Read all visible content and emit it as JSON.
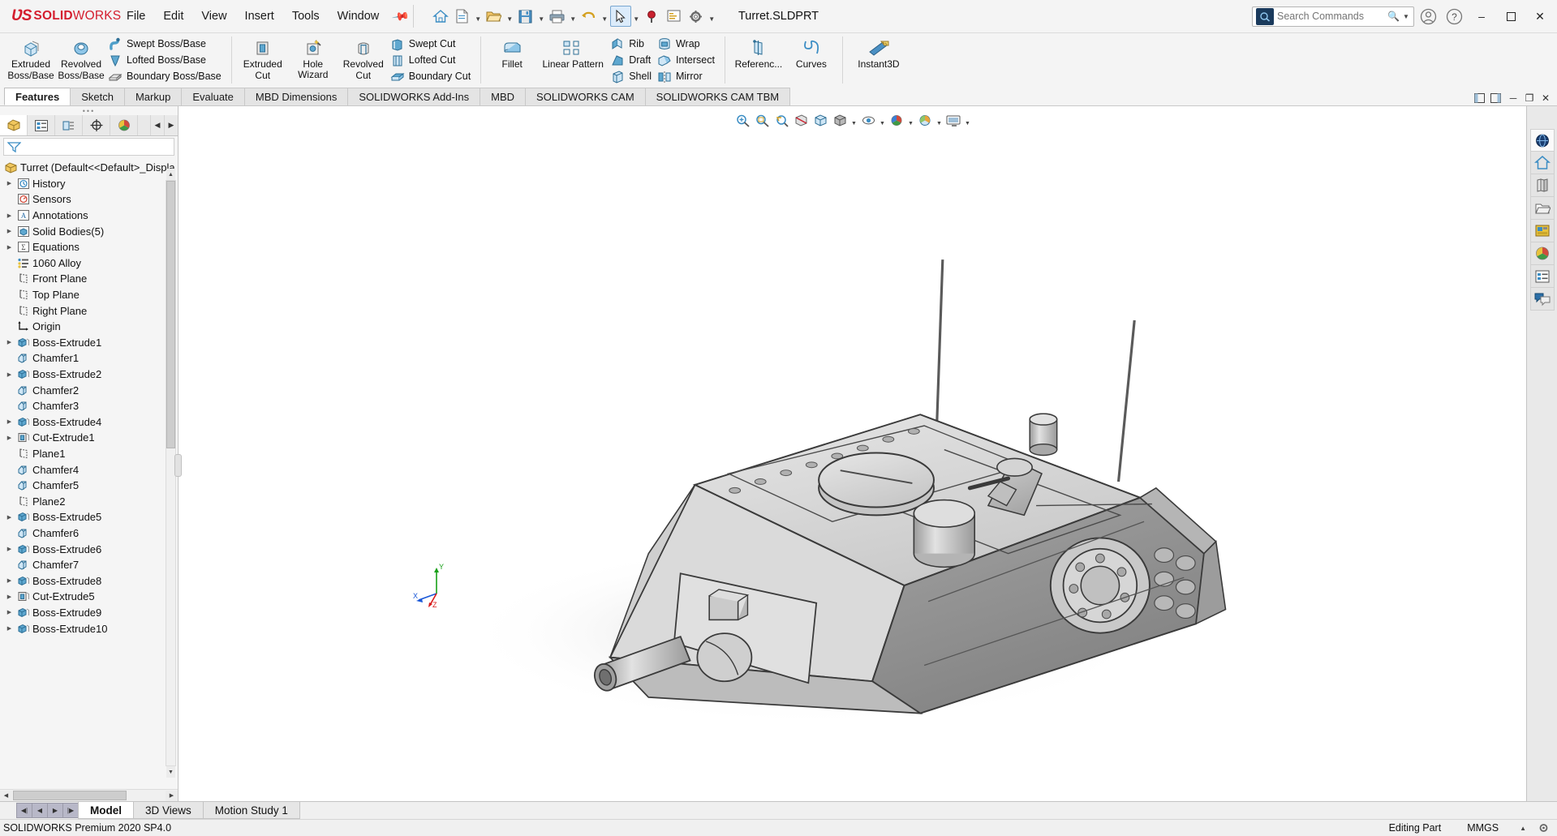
{
  "app": {
    "brand_bold": "SOLID",
    "brand_light": "WORKS",
    "window_title": "Turret.SLDPRT"
  },
  "menubar": {
    "items": [
      {
        "label": "File"
      },
      {
        "label": "Edit"
      },
      {
        "label": "View"
      },
      {
        "label": "Insert"
      },
      {
        "label": "Tools"
      },
      {
        "label": "Window"
      }
    ],
    "pin_icon": "pushpin-icon"
  },
  "quick_toolbar": {
    "buttons": [
      {
        "name": "home-icon",
        "caret": false
      },
      {
        "name": "new-document-icon",
        "caret": true
      },
      {
        "name": "open-folder-icon",
        "caret": true
      },
      {
        "name": "save-icon",
        "caret": true
      },
      {
        "name": "print-icon",
        "caret": true
      },
      {
        "name": "undo-icon",
        "caret": true
      },
      {
        "name": "select-pointer-icon",
        "caret": true
      },
      {
        "name": "magnifier-red-icon",
        "caret": false
      },
      {
        "name": "rebuild-icon",
        "caret": false
      },
      {
        "name": "options-gear-icon",
        "caret": true
      }
    ]
  },
  "search": {
    "placeholder": "Search Commands",
    "value": "",
    "icon": "search-icon",
    "caret": "chevron-down-icon"
  },
  "window_buttons": {
    "account_icon": "user-account-icon",
    "help_icon": "help-question-icon",
    "minimize": "–",
    "maximize": "❐",
    "close": "✕"
  },
  "ribbon": {
    "groups": [
      {
        "name": "features-boss",
        "big": [
          {
            "label_line1": "Extruded",
            "label_line2": "Boss/Base",
            "icon": "extruded-boss-icon",
            "caret": true
          },
          {
            "label_line1": "Revolved",
            "label_line2": "Boss/Base",
            "icon": "revolved-boss-icon",
            "caret": true
          }
        ],
        "small": [
          {
            "label": "Swept Boss/Base",
            "icon": "swept-boss-icon"
          },
          {
            "label": "Lofted Boss/Base",
            "icon": "lofted-boss-icon"
          },
          {
            "label": "Boundary Boss/Base",
            "icon": "boundary-boss-icon"
          }
        ]
      },
      {
        "name": "features-cut",
        "big": [
          {
            "label_line1": "Extruded",
            "label_line2": "Cut",
            "icon": "extruded-cut-icon",
            "caret": true
          },
          {
            "label_line1": "Hole Wizard",
            "label_line2": "",
            "icon": "hole-wizard-icon",
            "caret": true
          },
          {
            "label_line1": "Revolved",
            "label_line2": "Cut",
            "icon": "revolved-cut-icon",
            "caret": true
          }
        ],
        "small": [
          {
            "label": "Swept Cut",
            "icon": "swept-cut-icon"
          },
          {
            "label": "Lofted Cut",
            "icon": "lofted-cut-icon"
          },
          {
            "label": "Boundary Cut",
            "icon": "boundary-cut-icon"
          }
        ]
      },
      {
        "name": "features-modify",
        "big": [
          {
            "label_line1": "Fillet",
            "label_line2": "",
            "icon": "fillet-icon",
            "caret": true
          },
          {
            "label_line1": "Linear Pattern",
            "label_line2": "",
            "icon": "linear-pattern-icon",
            "caret": true
          }
        ],
        "small": [
          {
            "label": "Rib",
            "icon": "rib-icon"
          },
          {
            "label": "Draft",
            "icon": "draft-icon"
          },
          {
            "label": "Shell",
            "icon": "shell-icon"
          }
        ],
        "small2": [
          {
            "label": "Wrap",
            "icon": "wrap-icon"
          },
          {
            "label": "Intersect",
            "icon": "intersect-icon"
          },
          {
            "label": "Mirror",
            "icon": "mirror-icon"
          }
        ]
      },
      {
        "name": "features-reference",
        "big": [
          {
            "label_line1": "Referenc...",
            "label_line2": "",
            "icon": "reference-geometry-icon",
            "caret": true
          },
          {
            "label_line1": "Curves",
            "label_line2": "",
            "icon": "curves-icon",
            "caret": true
          }
        ]
      },
      {
        "name": "features-instant3d",
        "big": [
          {
            "label_line1": "Instant3D",
            "label_line2": "",
            "icon": "instant3d-icon",
            "caret": false
          }
        ]
      }
    ]
  },
  "ribbon_tabs": {
    "items": [
      {
        "label": "Features",
        "active": true
      },
      {
        "label": "Sketch",
        "active": false
      },
      {
        "label": "Markup",
        "active": false
      },
      {
        "label": "Evaluate",
        "active": false
      },
      {
        "label": "MBD Dimensions",
        "active": false
      },
      {
        "label": "SOLIDWORKS Add-Ins",
        "active": false
      },
      {
        "label": "MBD",
        "active": false
      },
      {
        "label": "SOLIDWORKS CAM",
        "active": false
      },
      {
        "label": "SOLIDWORKS CAM TBM",
        "active": false
      }
    ],
    "right_controls": [
      {
        "name": "panel-left-icon"
      },
      {
        "name": "panel-right-icon"
      },
      {
        "name": "minimize-doc-icon"
      },
      {
        "name": "restore-doc-icon"
      },
      {
        "name": "close-doc-icon"
      }
    ]
  },
  "feature_manager": {
    "tabs": [
      {
        "name": "feature-tree-tab",
        "icon": "feature-tree-icon",
        "active": true
      },
      {
        "name": "property-manager-tab",
        "icon": "property-manager-icon",
        "active": false
      },
      {
        "name": "configuration-manager-tab",
        "icon": "configuration-manager-icon",
        "active": false
      },
      {
        "name": "dimxpert-manager-tab",
        "icon": "dimxpert-icon",
        "active": false
      },
      {
        "name": "display-manager-tab",
        "icon": "display-manager-icon",
        "active": false
      }
    ],
    "filter_icon": "filter-funnel-icon",
    "filter_placeholder": "",
    "root": "Turret  (Default<<Default>_Displa",
    "items": [
      {
        "label": "History",
        "icon": "history-icon",
        "arrow": true,
        "indent": 1
      },
      {
        "label": "Sensors",
        "icon": "sensors-icon",
        "arrow": false,
        "indent": 1
      },
      {
        "label": "Annotations",
        "icon": "annotations-icon",
        "arrow": true,
        "indent": 1
      },
      {
        "label": "Solid Bodies(5)",
        "icon": "solid-bodies-icon",
        "arrow": true,
        "indent": 1
      },
      {
        "label": "Equations",
        "icon": "equations-icon",
        "arrow": true,
        "indent": 1
      },
      {
        "label": "1060 Alloy",
        "icon": "material-icon",
        "arrow": false,
        "indent": 1
      },
      {
        "label": "Front Plane",
        "icon": "plane-icon",
        "arrow": false,
        "indent": 1
      },
      {
        "label": "Top Plane",
        "icon": "plane-icon",
        "arrow": false,
        "indent": 1
      },
      {
        "label": "Right Plane",
        "icon": "plane-icon",
        "arrow": false,
        "indent": 1
      },
      {
        "label": "Origin",
        "icon": "origin-icon",
        "arrow": false,
        "indent": 1
      },
      {
        "label": "Boss-Extrude1",
        "icon": "boss-extrude-icon",
        "arrow": true,
        "indent": 1
      },
      {
        "label": "Chamfer1",
        "icon": "chamfer-icon",
        "arrow": false,
        "indent": 1
      },
      {
        "label": "Boss-Extrude2",
        "icon": "boss-extrude-icon",
        "arrow": true,
        "indent": 1
      },
      {
        "label": "Chamfer2",
        "icon": "chamfer-icon",
        "arrow": false,
        "indent": 1
      },
      {
        "label": "Chamfer3",
        "icon": "chamfer-icon",
        "arrow": false,
        "indent": 1
      },
      {
        "label": "Boss-Extrude4",
        "icon": "boss-extrude-icon",
        "arrow": true,
        "indent": 1
      },
      {
        "label": "Cut-Extrude1",
        "icon": "cut-extrude-icon",
        "arrow": true,
        "indent": 1
      },
      {
        "label": "Plane1",
        "icon": "plane-icon",
        "arrow": false,
        "indent": 1
      },
      {
        "label": "Chamfer4",
        "icon": "chamfer-icon",
        "arrow": false,
        "indent": 1
      },
      {
        "label": "Chamfer5",
        "icon": "chamfer-icon",
        "arrow": false,
        "indent": 1
      },
      {
        "label": "Plane2",
        "icon": "plane-icon",
        "arrow": false,
        "indent": 1
      },
      {
        "label": "Boss-Extrude5",
        "icon": "boss-extrude-icon",
        "arrow": true,
        "indent": 1
      },
      {
        "label": "Chamfer6",
        "icon": "chamfer-icon",
        "arrow": false,
        "indent": 1
      },
      {
        "label": "Boss-Extrude6",
        "icon": "boss-extrude-icon",
        "arrow": true,
        "indent": 1
      },
      {
        "label": "Chamfer7",
        "icon": "chamfer-icon",
        "arrow": false,
        "indent": 1
      },
      {
        "label": "Boss-Extrude8",
        "icon": "boss-extrude-icon",
        "arrow": true,
        "indent": 1
      },
      {
        "label": "Cut-Extrude5",
        "icon": "cut-extrude-icon",
        "arrow": true,
        "indent": 1
      },
      {
        "label": "Boss-Extrude9",
        "icon": "boss-extrude-icon",
        "arrow": true,
        "indent": 1
      },
      {
        "label": "Boss-Extrude10",
        "icon": "boss-extrude-icon",
        "arrow": true,
        "indent": 1
      }
    ]
  },
  "heads_up_view_toolbar": {
    "buttons": [
      {
        "name": "zoom-to-fit-icon",
        "caret": false
      },
      {
        "name": "zoom-to-area-icon",
        "caret": false
      },
      {
        "name": "previous-view-icon",
        "caret": false
      },
      {
        "name": "section-view-icon",
        "caret": false
      },
      {
        "name": "view-orientation-icon",
        "caret": false
      },
      {
        "name": "display-style-icon",
        "caret": true
      },
      {
        "name": "hide-show-items-icon",
        "caret": true
      },
      {
        "name": "edit-appearance-icon",
        "caret": true
      },
      {
        "name": "apply-scene-icon",
        "caret": true
      },
      {
        "name": "view-settings-icon",
        "caret": true
      },
      {
        "name": "viewport-icon",
        "caret": true
      }
    ]
  },
  "right_task_pane": {
    "buttons": [
      {
        "name": "solidworks-resources-icon"
      },
      {
        "name": "design-library-icon"
      },
      {
        "name": "file-explorer-icon"
      },
      {
        "name": "view-palette-icon"
      },
      {
        "name": "appearances-scenes-icon"
      },
      {
        "name": "custom-properties-icon"
      },
      {
        "name": "solidworks-forum-icon"
      }
    ]
  },
  "triad": {
    "x_label": "X",
    "y_label": "Y",
    "z_label": "Z"
  },
  "bottom_tabs": {
    "nav": [
      "⏮",
      "◀",
      "▶",
      "⏭"
    ],
    "items": [
      {
        "label": "Model",
        "active": true
      },
      {
        "label": "3D Views",
        "active": false
      },
      {
        "label": "Motion Study 1",
        "active": false
      }
    ]
  },
  "statusbar": {
    "left": "SOLIDWORKS Premium 2020 SP4.0",
    "mode": "Editing Part",
    "units": "MMGS",
    "caret": "▲",
    "settings_icon": "status-settings-icon"
  },
  "colors": {
    "brand_red": "#d41e2e",
    "accent_blue": "#3b8dc4",
    "tree_text": "#1a1a1a",
    "model_light": "#d8d8d8",
    "model_mid": "#b3b3b3",
    "model_dark": "#8f8f8f"
  }
}
